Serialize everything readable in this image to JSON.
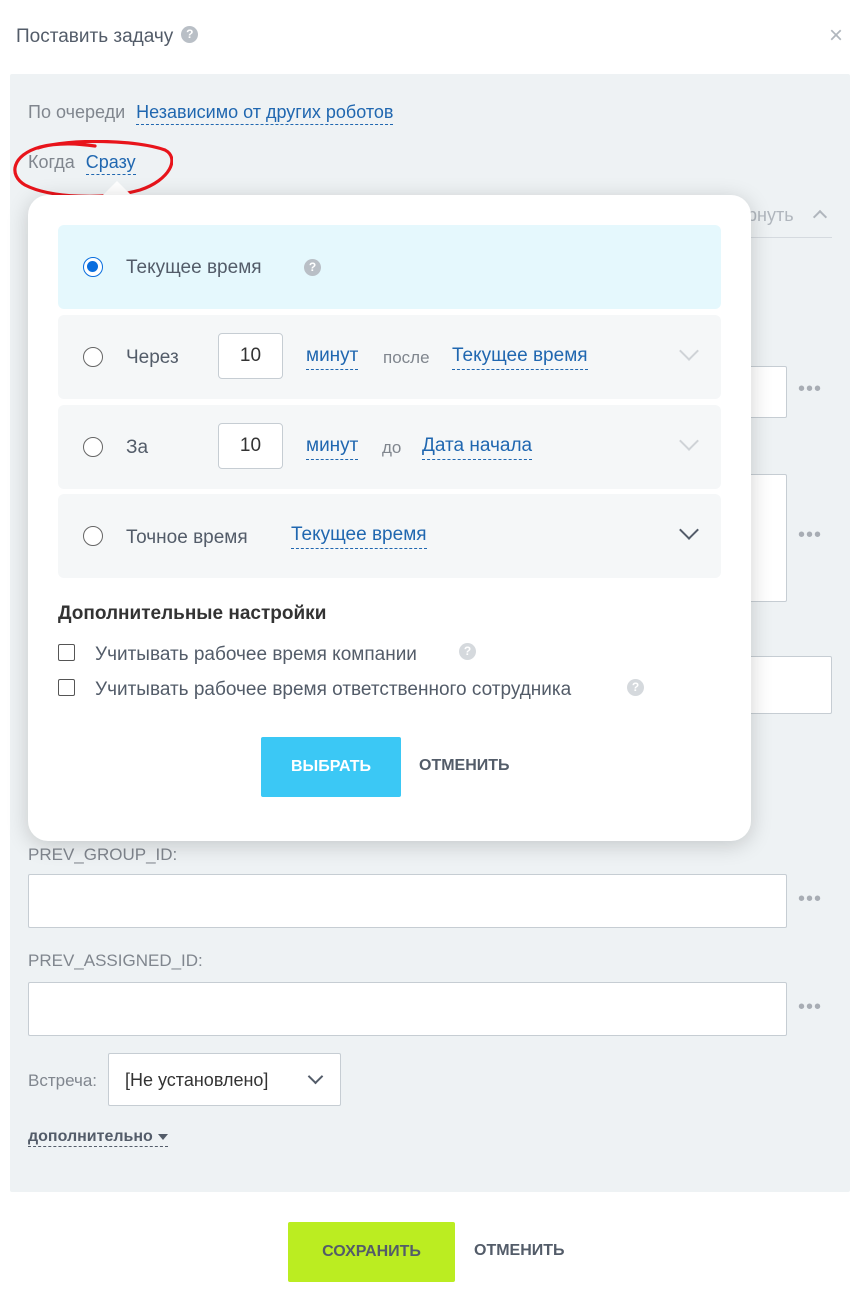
{
  "dialog": {
    "title": "Поставить задачу",
    "help_icon": "?",
    "close_icon": "×"
  },
  "settings": {
    "queue_label": "По очереди",
    "queue_value": "Независимо от других роботов",
    "when_label": "Когда",
    "when_value": "Сразу",
    "collapse_text": "рнуть"
  },
  "popup": {
    "options": [
      {
        "label": "Текущее время",
        "selected": true
      },
      {
        "label": "Через",
        "number": "10",
        "unit": "минут",
        "relation": "после",
        "target": "Текущее время"
      },
      {
        "label": "За",
        "number": "10",
        "unit": "минут",
        "relation": "до",
        "target": "Дата начала"
      },
      {
        "label": "Точное время",
        "target": "Текущее время"
      }
    ],
    "advanced_title": "Дополнительные настройки",
    "checkbox_company": "Учитывать рабочее время компании",
    "checkbox_employee": "Учитывать рабочее время ответственного сотрудника",
    "select_button": "ВЫБРАТЬ",
    "cancel_button": "ОТМЕНИТЬ"
  },
  "fields": {
    "prev_group_label": "PREV_GROUP_ID:",
    "prev_assigned_label": "PREV_ASSIGNED_ID:",
    "meeting_label": "Встреча:",
    "meeting_value": "[Не установлено]",
    "more_link": "дополнительно",
    "dots": "•••"
  },
  "footer": {
    "save_button": "СОХРАНИТЬ",
    "cancel_button": "ОТМЕНИТЬ"
  },
  "colors": {
    "accent_blue": "#3bc8f5",
    "save_green": "#bbed21",
    "link_blue": "#2067b0",
    "annotation_red": "#e8141b"
  }
}
